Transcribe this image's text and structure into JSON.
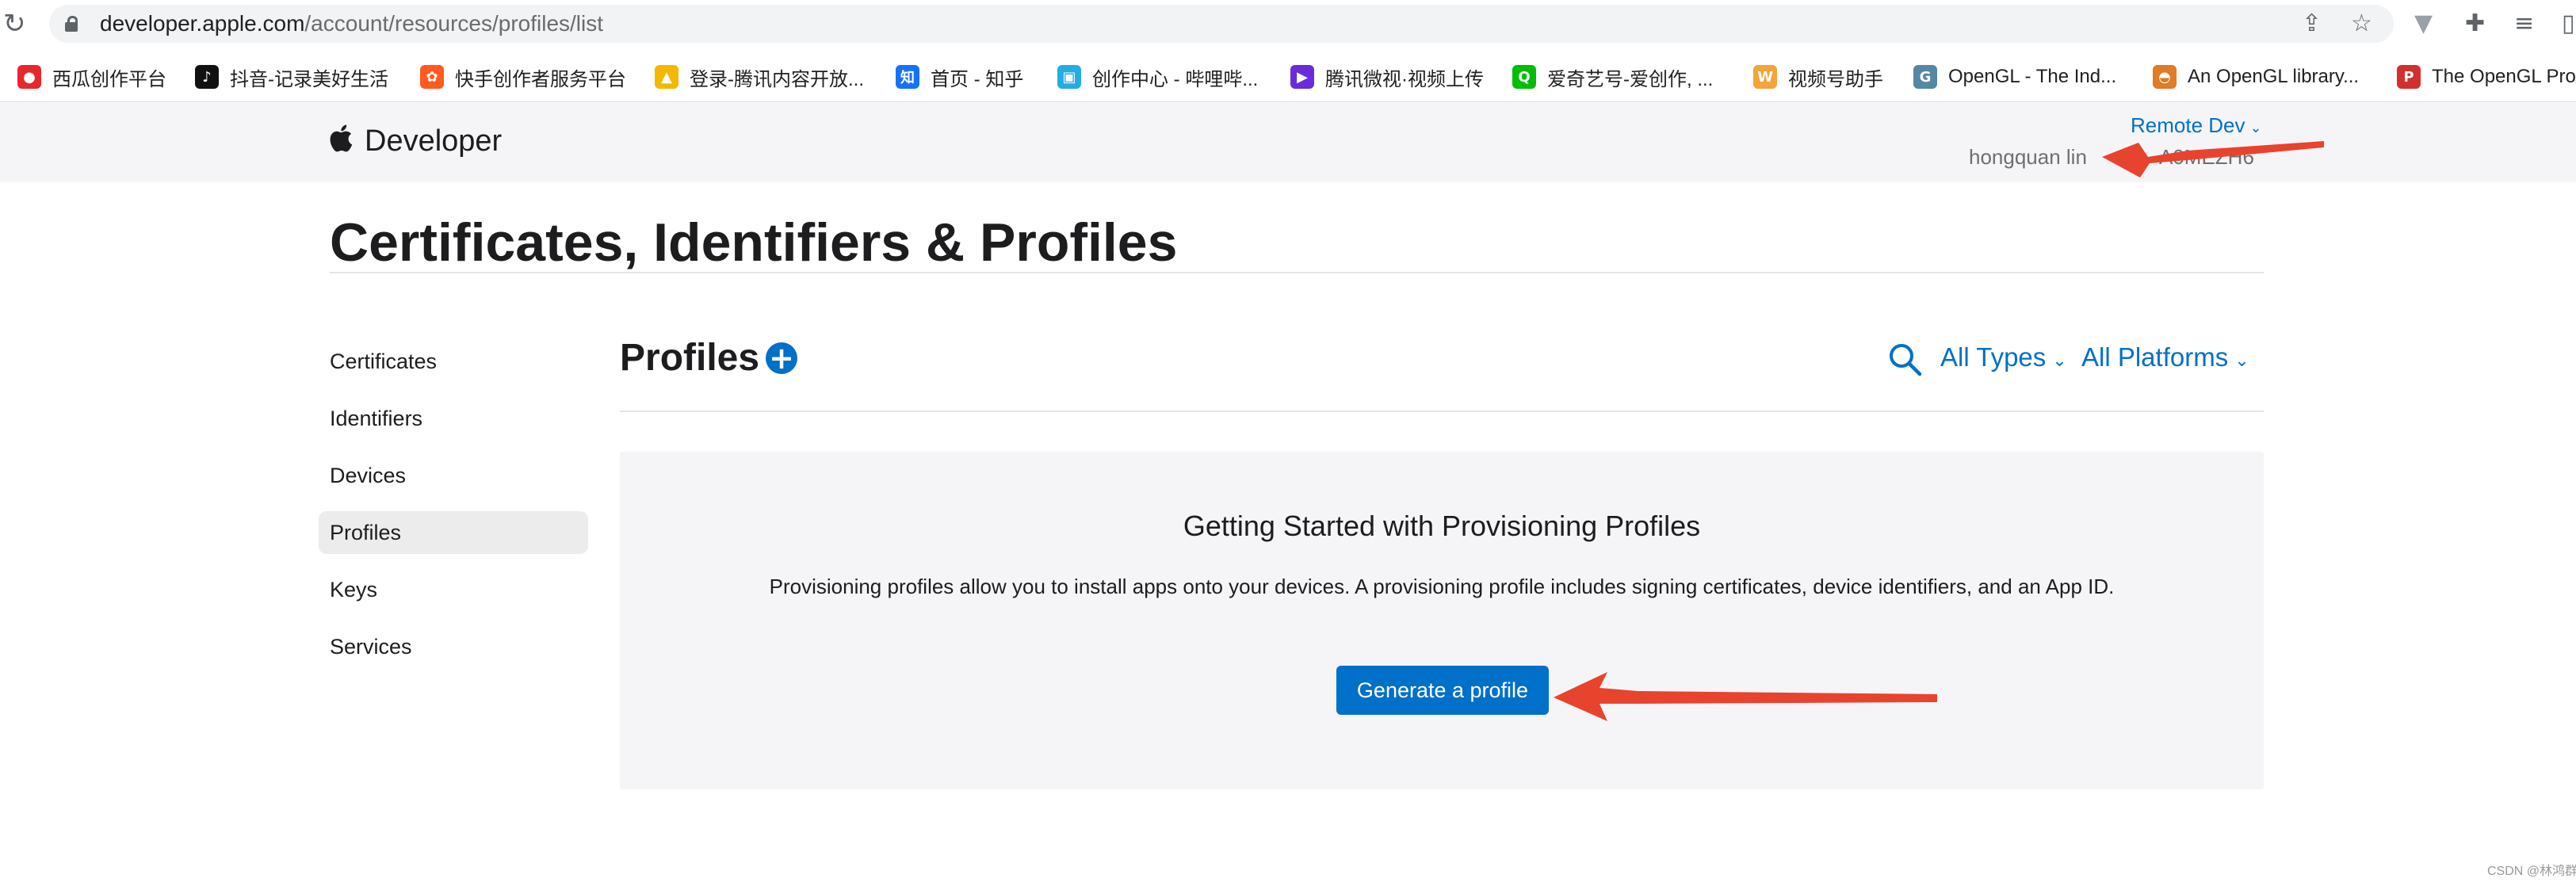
{
  "browser": {
    "url_host": "developer.apple.com",
    "url_path": "/account/resources/profiles/list",
    "reload_glyph": "↻",
    "share_glyph": "⇪",
    "star_glyph": "☆",
    "ext1_glyph": "▼",
    "ext2_glyph": "✚",
    "ext3_glyph": "≡",
    "ext4_glyph": "▯"
  },
  "bookmarks": [
    {
      "label": "西瓜创作平台",
      "icon": "xigua-icon",
      "color": "#e8272c",
      "glyph": "●"
    },
    {
      "label": "抖音-记录美好生活",
      "icon": "douyin-icon",
      "color": "#111111",
      "glyph": "♪"
    },
    {
      "label": "快手创作者服务平台",
      "icon": "kuaishou-icon",
      "color": "#ff5a1f",
      "glyph": "✿"
    },
    {
      "label": "登录-腾讯内容开放...",
      "icon": "tencent-bell-icon",
      "color": "#f5b800",
      "glyph": "▲"
    },
    {
      "label": "首页 - 知乎",
      "icon": "zhihu-icon",
      "color": "#1772f6",
      "glyph": "知"
    },
    {
      "label": "创作中心 - 哔哩哔...",
      "icon": "bilibili-icon",
      "color": "#23ade5",
      "glyph": "▣"
    },
    {
      "label": "腾讯微视·视频上传",
      "icon": "weishi-icon",
      "color": "#6a2bd9",
      "glyph": "▶"
    },
    {
      "label": "爱奇艺号-爱创作, ...",
      "icon": "iqiyi-icon",
      "color": "#00be06",
      "glyph": "Q"
    },
    {
      "label": "视频号助手",
      "icon": "channels-icon",
      "color": "#f2a53a",
      "glyph": "W"
    },
    {
      "label": "OpenGL - The Ind...",
      "icon": "opengl-icon",
      "color": "#5586a4",
      "glyph": "G"
    },
    {
      "label": "An OpenGL library...",
      "icon": "glfw-icon",
      "color": "#e07b26",
      "glyph": "◓"
    },
    {
      "label": "The OpenGL Pro",
      "icon": "opengl-pro-icon",
      "color": "#d32f2f",
      "glyph": "P"
    }
  ],
  "header": {
    "brand": "Developer",
    "account_menu": "Remote Dev",
    "user_name": "hongquan lin",
    "team_id_fragment": "A0MEZH6"
  },
  "page_title": "Certificates, Identifiers & Profiles",
  "sidebar": {
    "items": [
      {
        "label": "Certificates",
        "active": false
      },
      {
        "label": "Identifiers",
        "active": false
      },
      {
        "label": "Devices",
        "active": false
      },
      {
        "label": "Profiles",
        "active": true
      },
      {
        "label": "Keys",
        "active": false
      },
      {
        "label": "Services",
        "active": false
      }
    ]
  },
  "main": {
    "section_title": "Profiles",
    "add_glyph": "+",
    "filters": {
      "types": "All Types",
      "platforms": "All Platforms",
      "chevron": "⌄"
    },
    "empty_state": {
      "title": "Getting Started with Provisioning Profiles",
      "description": "Provisioning profiles allow you to install apps onto your devices. A provisioning profile includes signing certificates, device identifiers, and an App ID.",
      "button": "Generate a profile"
    }
  },
  "annotations": {
    "arrow_color": "#e8432d"
  },
  "watermark": "CSDN @林鸿群",
  "colors": {
    "link_blue": "#0070c9",
    "header_bg": "#f5f5f7",
    "panel_bg": "#f5f5f7"
  }
}
